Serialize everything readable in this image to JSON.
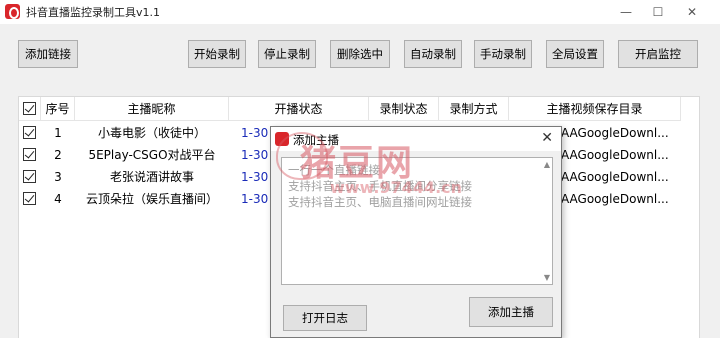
{
  "window": {
    "title": "抖音直播监控录制工具v1.1",
    "minimize": "—",
    "maximize": "☐",
    "close": "✕"
  },
  "toolbar": {
    "add_link": "添加链接",
    "start_record": "开始录制",
    "stop_record": "停止录制",
    "delete_selected": "删除选中",
    "auto_record": "自动录制",
    "manual_record": "手动录制",
    "global_settings": "全局设置",
    "start_monitor": "开启监控"
  },
  "table": {
    "headers": [
      "序号",
      "主播昵称",
      "开播状态",
      "录制状态",
      "录制方式",
      "主播视频保存目录"
    ],
    "rows": [
      {
        "index": "1",
        "name": "小毒电影（收徒中）",
        "status": "1-30",
        "dir": "AAGoogleDownl..."
      },
      {
        "index": "2",
        "name": "5EPlay-CSGO对战平台",
        "status": "1-30",
        "dir": "AAGoogleDownl..."
      },
      {
        "index": "3",
        "name": "老张说酒讲故事",
        "status": "1-30",
        "dir": "AAGoogleDownl..."
      },
      {
        "index": "4",
        "name": "云顶朵拉（娱乐直播间）",
        "status": "1-30",
        "dir": "AAGoogleDownl..."
      }
    ]
  },
  "dialog": {
    "title": "添加主播",
    "close": "✕",
    "placeholder": [
      "一行一个直播链接",
      "支持抖音主页、手机直播间分享链接",
      "支持抖音主页、电脑直播间网址链接"
    ],
    "open_log": "打开日志",
    "add_anchor": "添加主播"
  },
  "watermark": {
    "text": "猪豆网",
    "url": "www.97444.cn"
  }
}
